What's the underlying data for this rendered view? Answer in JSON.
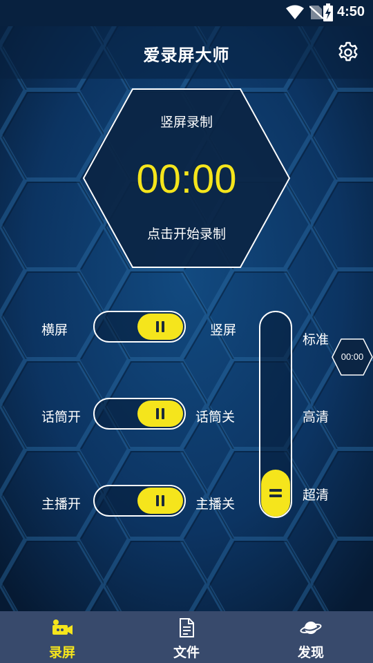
{
  "status_bar": {
    "time": "4:50",
    "icons": [
      "wifi-icon",
      "no-sim-icon",
      "battery-charging-icon"
    ]
  },
  "header": {
    "title": "爱录屏大师",
    "settings_icon": "gear-icon"
  },
  "timer": {
    "mode": "竖屏录制",
    "time": "00:00",
    "hint": "点击开始录制"
  },
  "toggles": [
    {
      "left_label": "横屏",
      "right_label": "竖屏"
    },
    {
      "left_label": "话筒开",
      "right_label": "话筒关"
    },
    {
      "left_label": "主播开",
      "right_label": "主播关"
    }
  ],
  "quality": {
    "options": [
      "标准",
      "高清",
      "超清"
    ],
    "selected": "超清"
  },
  "floating_timer": "00:00",
  "bottom_nav": [
    {
      "label": "录屏",
      "icon": "camera-icon",
      "active": true
    },
    {
      "label": "文件",
      "icon": "document-icon",
      "active": false
    },
    {
      "label": "发现",
      "icon": "planet-icon",
      "active": false
    }
  ],
  "colors": {
    "accent": "#f5e51c",
    "background": "#0d2f55",
    "nav_bar": "#384a6c",
    "status_bar": "#08213f"
  }
}
